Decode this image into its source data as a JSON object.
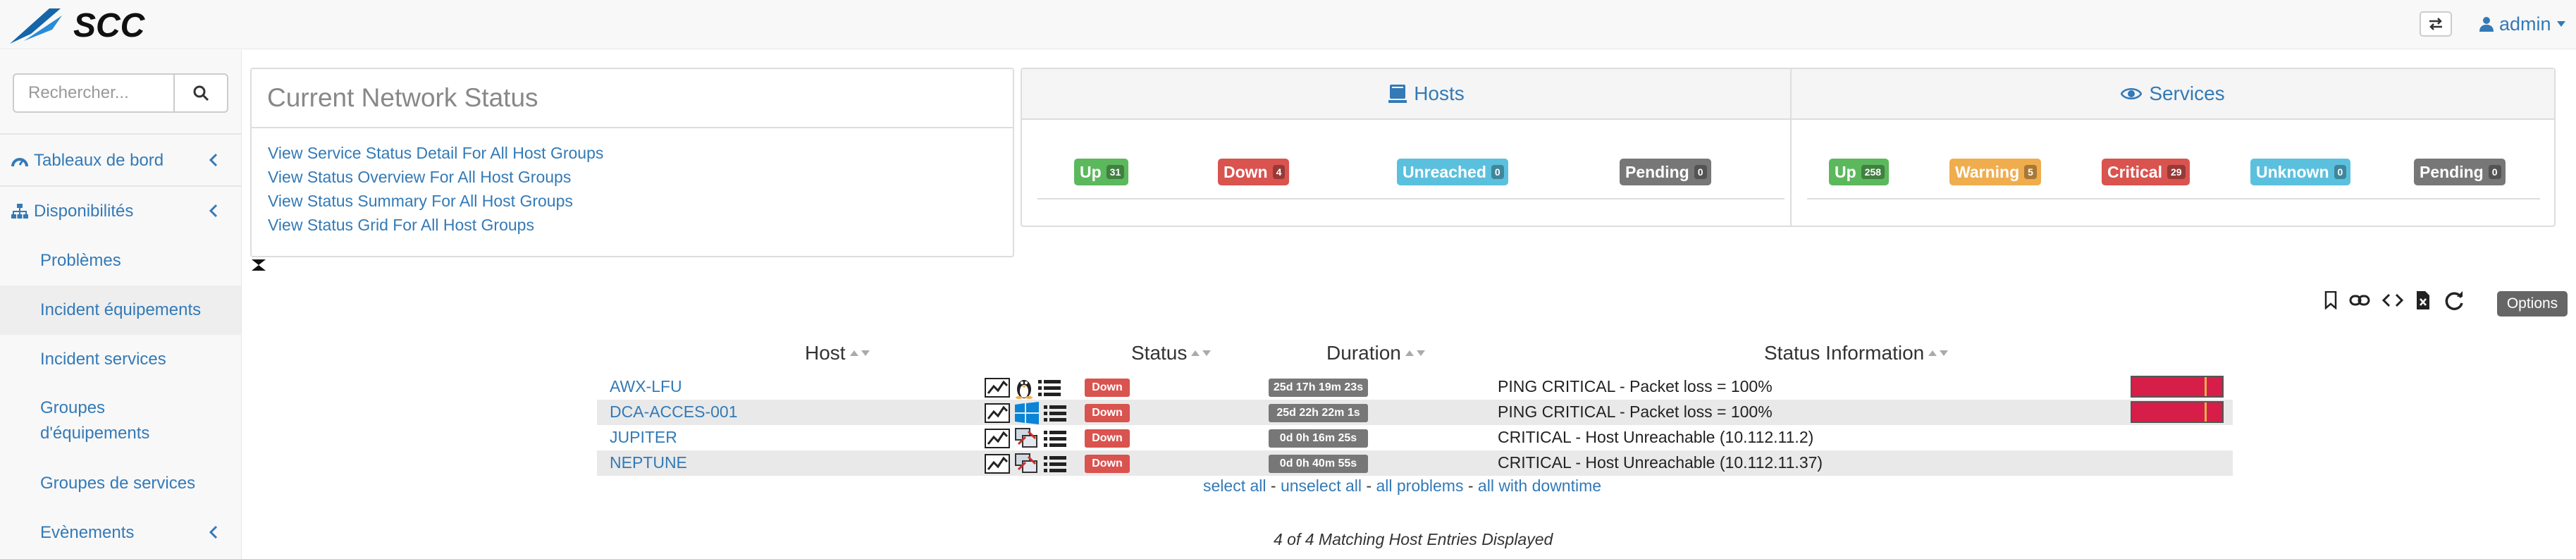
{
  "app": {
    "logo_text": "SCC",
    "user_label": "admin"
  },
  "sidebar": {
    "search_placeholder": "Rechercher...",
    "items": [
      {
        "label": "Tableaux de bord",
        "level": "top",
        "icon": "dashboard-icon",
        "expandable": true
      },
      {
        "label": "Disponibilités",
        "level": "top",
        "icon": "sitemap-icon",
        "expandable": true
      },
      {
        "label": "Problèmes",
        "level": "sub"
      },
      {
        "label": "Incident équipements",
        "level": "sub",
        "active": true
      },
      {
        "label": "Incident services",
        "level": "sub"
      },
      {
        "label": "Groupes d'équipements",
        "level": "sub"
      },
      {
        "label": "Groupes de services",
        "level": "sub"
      },
      {
        "label": "Evènements",
        "level": "sub",
        "expandable": true
      }
    ]
  },
  "network_status": {
    "title": "Current Network Status",
    "links": [
      "View Service Status Detail For All Host Groups",
      "View Status Overview For All Host Groups",
      "View Status Summary For All Host Groups",
      "View Status Grid For All Host Groups"
    ]
  },
  "hosts_summary": {
    "title": "Hosts",
    "icon": "server-icon",
    "labels": [
      {
        "text": "Up",
        "count": "31",
        "color": "#5cb85c"
      },
      {
        "text": "Down",
        "count": "4",
        "color": "#d9534f"
      },
      {
        "text": "Unreached",
        "count": "0",
        "color": "#5bc0de"
      },
      {
        "text": "Pending",
        "count": "0",
        "color": "#777777"
      }
    ]
  },
  "services_summary": {
    "title": "Services",
    "icon": "eye-icon",
    "labels": [
      {
        "text": "Up",
        "count": "258",
        "color": "#5cb85c"
      },
      {
        "text": "Warning",
        "count": "5",
        "color": "#f0ad4e"
      },
      {
        "text": "Critical",
        "count": "29",
        "color": "#d9534f"
      },
      {
        "text": "Unknown",
        "count": "0",
        "color": "#5bc0de"
      },
      {
        "text": "Pending",
        "count": "0",
        "color": "#777777"
      }
    ]
  },
  "toolbar": {
    "icons": [
      "bookmark-icon",
      "link-icon",
      "code-icon",
      "export-csv-icon",
      "refresh-icon"
    ],
    "options_label": "Options"
  },
  "table": {
    "columns": [
      "Host",
      "Status",
      "Duration",
      "Status Information"
    ],
    "rows": [
      {
        "host": "AWX-LFU",
        "os": "linux",
        "status": "Down",
        "duration": "25d 17h 19m 23s",
        "info": "PING CRITICAL - Packet loss = 100%"
      },
      {
        "host": "DCA-ACCES-001",
        "os": "windows",
        "status": "Down",
        "duration": "25d 22h 22m 1s",
        "info": "PING CRITICAL - Packet loss = 100%"
      },
      {
        "host": "JUPITER",
        "os": "network",
        "status": "Down",
        "duration": "0d 0h 16m 25s",
        "info": "CRITICAL - Host Unreachable (10.112.11.2)"
      },
      {
        "host": "NEPTUNE",
        "os": "network",
        "status": "Down",
        "duration": "0d 0h 40m 55s",
        "info": "CRITICAL - Host Unreachable (10.112.11.37)"
      }
    ]
  },
  "selection": {
    "select_all": "select all",
    "unselect_all": "unselect all",
    "all_problems": "all problems",
    "all_with_downtime": "all with downtime",
    "separator": "-"
  },
  "footer": {
    "matching_text": "4 of 4 Matching Host Entries Displayed"
  }
}
